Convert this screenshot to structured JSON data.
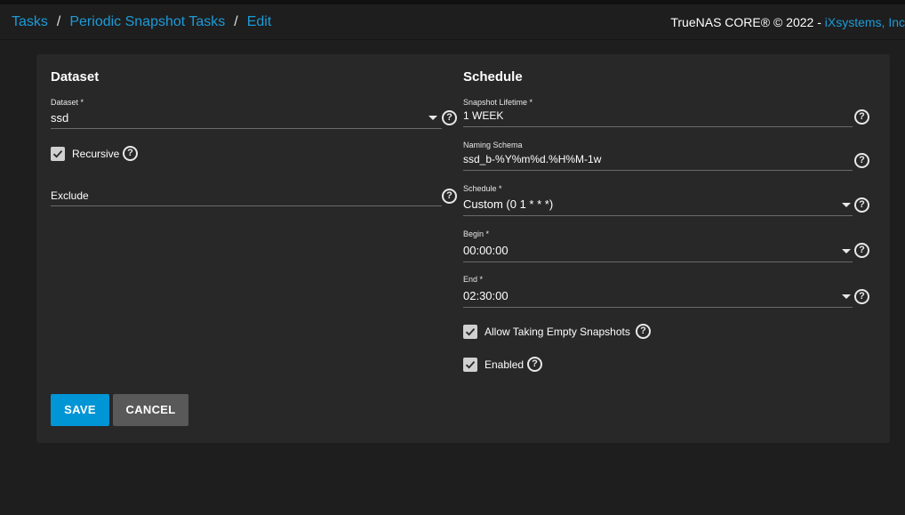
{
  "breadcrumb": {
    "items": [
      "Tasks",
      "Periodic Snapshot Tasks",
      "Edit"
    ],
    "separator": "/"
  },
  "header": {
    "copyright": "TrueNAS CORE® © 2022 - ",
    "vendor_link": "iXsystems, Inc"
  },
  "colors": {
    "accent": "#0095d5",
    "link": "#1c9bd8",
    "card": "#282828",
    "background": "#1e1e1e"
  },
  "dataset_section": {
    "title": "Dataset",
    "dataset": {
      "label": "Dataset *",
      "value": "ssd"
    },
    "recursive": {
      "label": "Recursive",
      "checked": true
    },
    "exclude": {
      "placeholder": "Exclude",
      "value": ""
    }
  },
  "schedule_section": {
    "title": "Schedule",
    "snapshot_lifetime": {
      "label": "Snapshot Lifetime *",
      "value": "1 WEEK"
    },
    "naming_schema": {
      "label": "Naming Schema",
      "value": "ssd_b-%Y%m%d.%H%M-1w"
    },
    "schedule": {
      "label": "Schedule *",
      "value": "Custom (0 1 * * *)"
    },
    "begin": {
      "label": "Begin *",
      "value": "00:00:00"
    },
    "end": {
      "label": "End *",
      "value": "02:30:00"
    },
    "allow_empty": {
      "label": "Allow Taking Empty Snapshots",
      "checked": true
    },
    "enabled": {
      "label": "Enabled",
      "checked": true
    }
  },
  "actions": {
    "save_label": "SAVE",
    "cancel_label": "CANCEL"
  },
  "icons": {
    "help": "help-circle-icon",
    "dropdown": "chevron-down-icon",
    "check": "check-icon"
  }
}
